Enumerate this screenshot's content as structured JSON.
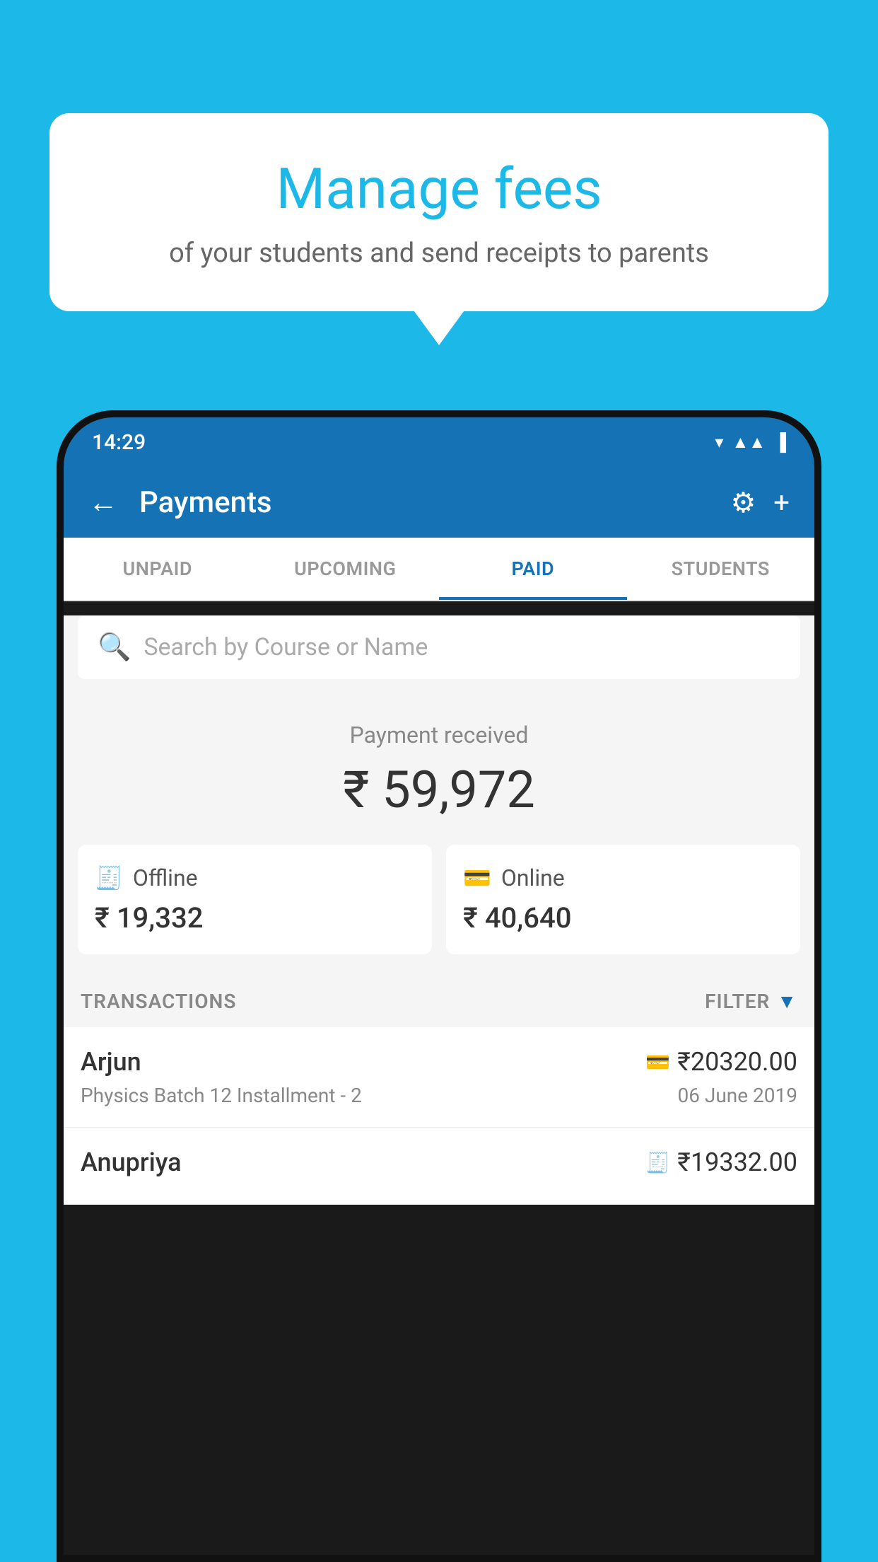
{
  "background_color": "#1BB8E8",
  "bubble": {
    "title": "Manage fees",
    "subtitle": "of your students and send receipts to parents"
  },
  "status_bar": {
    "time": "14:29"
  },
  "nav": {
    "title": "Payments",
    "back_label": "←",
    "settings_label": "⚙",
    "add_label": "+"
  },
  "tabs": [
    {
      "label": "UNPAID",
      "active": false
    },
    {
      "label": "UPCOMING",
      "active": false
    },
    {
      "label": "PAID",
      "active": true
    },
    {
      "label": "STUDENTS",
      "active": false
    }
  ],
  "search": {
    "placeholder": "Search by Course or Name"
  },
  "payment": {
    "label": "Payment received",
    "amount": "₹ 59,972",
    "offline_label": "Offline",
    "offline_amount": "₹ 19,332",
    "online_label": "Online",
    "online_amount": "₹ 40,640"
  },
  "transactions": {
    "label": "TRANSACTIONS",
    "filter_label": "FILTER"
  },
  "transaction_list": [
    {
      "name": "Arjun",
      "amount": "₹20320.00",
      "description": "Physics Batch 12 Installment - 2",
      "date": "06 June 2019",
      "mode": "online"
    },
    {
      "name": "Anupriya",
      "amount": "₹19332.00",
      "description": "",
      "date": "",
      "mode": "offline"
    }
  ]
}
